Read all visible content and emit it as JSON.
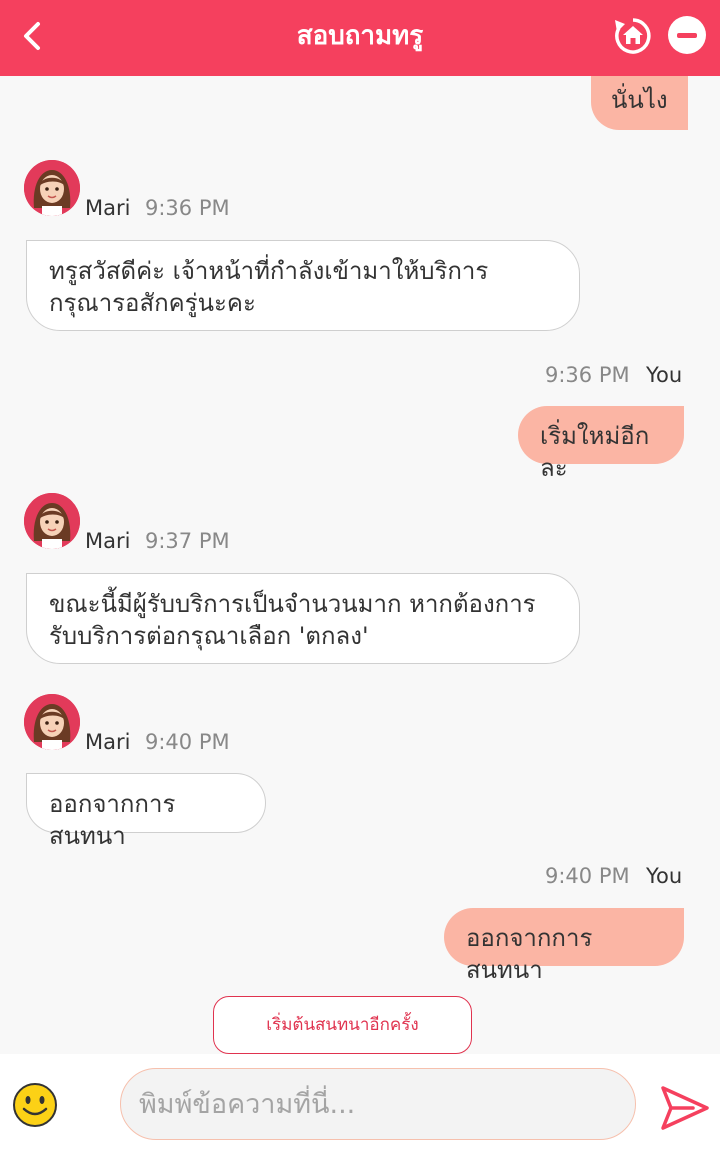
{
  "header": {
    "title": "สอบถามทรู",
    "background_color": "#f5405e"
  },
  "messages": [
    {
      "sender": "user",
      "text": "นั่นไง"
    },
    {
      "sender": "bot",
      "name": "Mari",
      "time": "9:36 PM",
      "text": "ทรูสวัสดีค่ะ เจ้าหน้าที่กำลังเข้ามาให้บริการ กรุณารอสักครู่นะคะ"
    },
    {
      "sender": "user",
      "name": "You",
      "time": "9:36 PM",
      "text": "เริ่มใหม่อีกละ"
    },
    {
      "sender": "bot",
      "name": "Mari",
      "time": "9:37 PM",
      "text": "ขณะนี้มีผู้รับบริการเป็นจำนวนมาก หากต้องการรับบริการต่อกรุณาเลือก 'ตกลง'"
    },
    {
      "sender": "bot",
      "name": "Mari",
      "time": "9:40 PM",
      "text": "ออกจากการสนทนา"
    },
    {
      "sender": "user",
      "name": "You",
      "time": "9:40 PM",
      "text": "ออกจากการสนทนา"
    }
  ],
  "restart_button": {
    "label": "เริ่มต้นสนทนาอีกครั้ง"
  },
  "composer": {
    "placeholder": "พิมพ์ข้อความที่นี่...",
    "value": ""
  },
  "icons": {
    "back": "chevron-left-icon",
    "home": "home-icon",
    "close": "minus-circle-icon",
    "emoji": "smiley-icon",
    "send": "send-icon"
  },
  "colors": {
    "accent": "#f5405e",
    "user_bubble": "#fbb5a4",
    "bot_bubble": "#ffffff"
  }
}
